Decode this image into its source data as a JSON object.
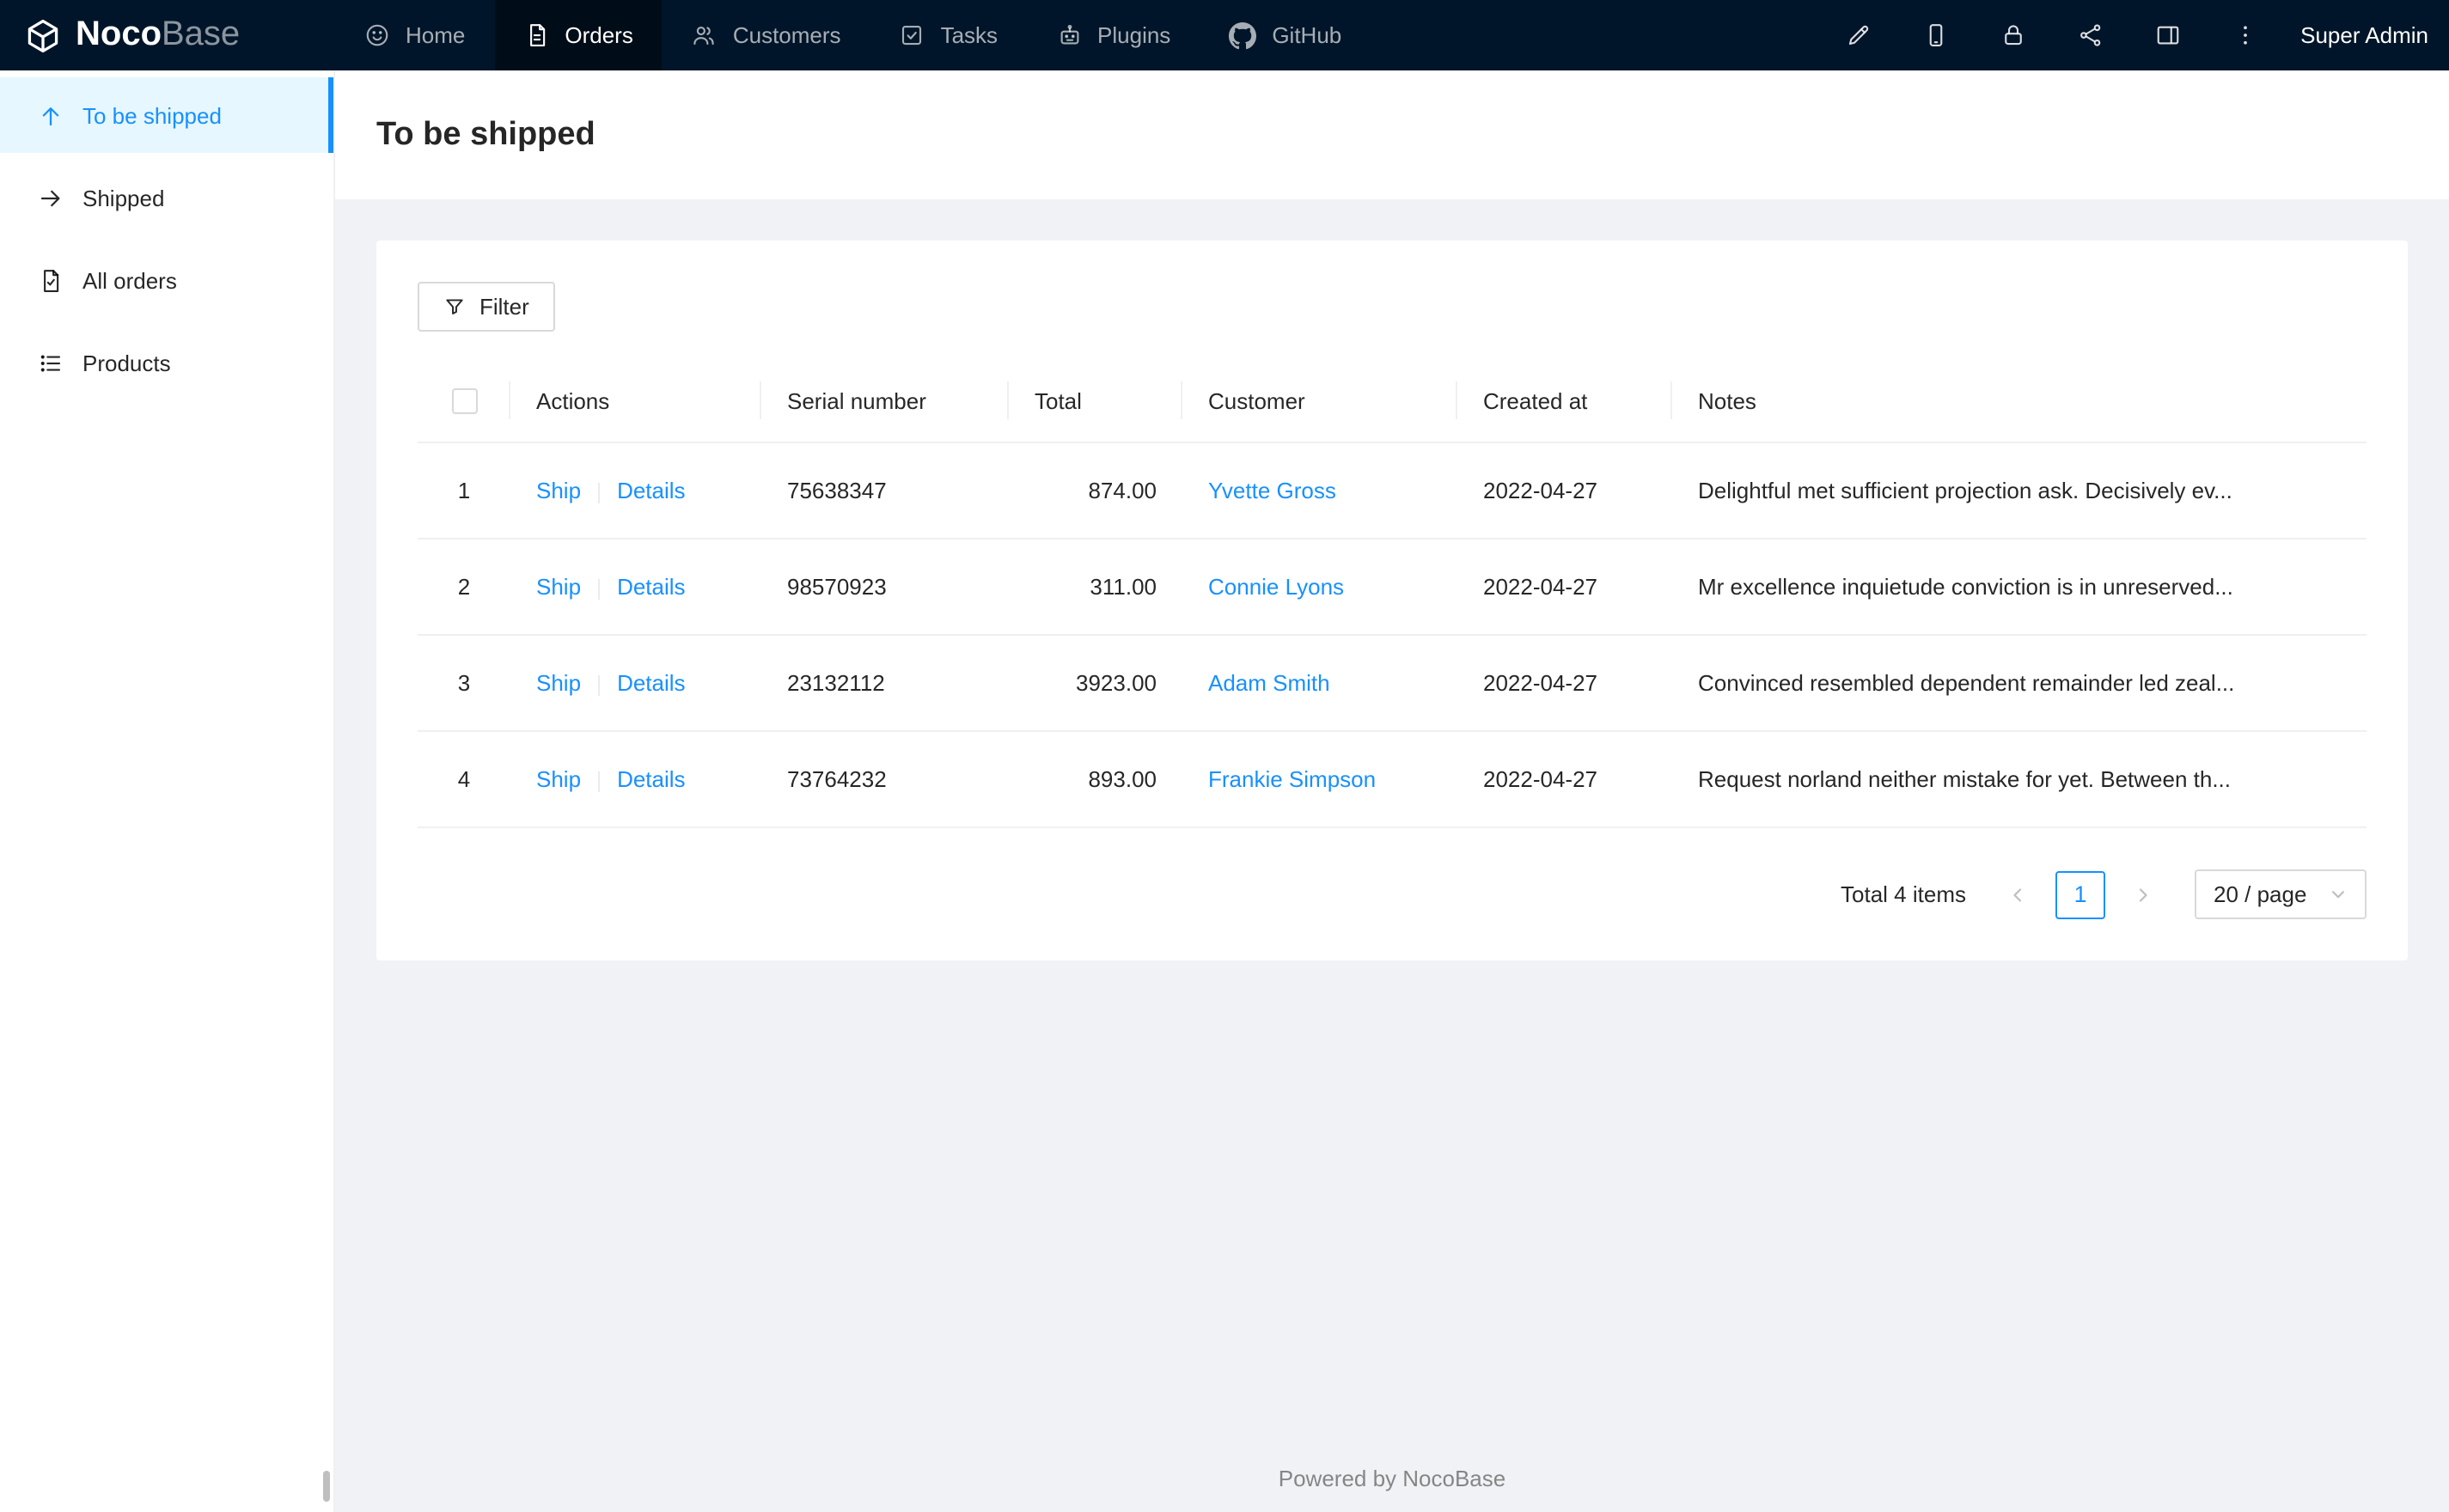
{
  "navbar": {
    "logo": {
      "bold": "Noco",
      "light": "Base"
    },
    "items": [
      {
        "label": "Home"
      },
      {
        "label": "Orders"
      },
      {
        "label": "Customers"
      },
      {
        "label": "Tasks"
      },
      {
        "label": "Plugins"
      },
      {
        "label": "GitHub"
      }
    ],
    "user": "Super Admin"
  },
  "sidebar": {
    "items": [
      {
        "label": "To be shipped"
      },
      {
        "label": "Shipped"
      },
      {
        "label": "All orders"
      },
      {
        "label": "Products"
      }
    ]
  },
  "page": {
    "title": "To be shipped"
  },
  "toolbar": {
    "filter_label": "Filter"
  },
  "table": {
    "columns": [
      "Actions",
      "Serial number",
      "Total",
      "Customer",
      "Created at",
      "Notes"
    ],
    "rows": [
      {
        "index": "1",
        "ship": "Ship",
        "details": "Details",
        "serial": "75638347",
        "total": "874.00",
        "customer": "Yvette Gross",
        "created_at": "2022-04-27",
        "notes": "Delightful met sufficient projection ask. Decisively ev..."
      },
      {
        "index": "2",
        "ship": "Ship",
        "details": "Details",
        "serial": "98570923",
        "total": "311.00",
        "customer": "Connie Lyons",
        "created_at": "2022-04-27",
        "notes": "Mr excellence inquietude conviction is in unreserved..."
      },
      {
        "index": "3",
        "ship": "Ship",
        "details": "Details",
        "serial": "23132112",
        "total": "3923.00",
        "customer": "Adam Smith",
        "created_at": "2022-04-27",
        "notes": "Convinced resembled dependent remainder led zeal..."
      },
      {
        "index": "4",
        "ship": "Ship",
        "details": "Details",
        "serial": "73764232",
        "total": "893.00",
        "customer": "Frankie Simpson",
        "created_at": "2022-04-27",
        "notes": "Request norland neither mistake for yet. Between th..."
      }
    ]
  },
  "pagination": {
    "total_text": "Total 4 items",
    "current_page": "1",
    "page_size": "20 / page"
  },
  "footer": {
    "text": "Powered by NocoBase"
  },
  "colors": {
    "accent": "#1890ff",
    "navbar_bg": "#001529",
    "nav_active_bg": "#000c17",
    "sidebar_selected_bg": "#e6f7ff",
    "content_bg": "#f0f2f5",
    "border": "#f0f0f0",
    "link": "#1890ff"
  }
}
